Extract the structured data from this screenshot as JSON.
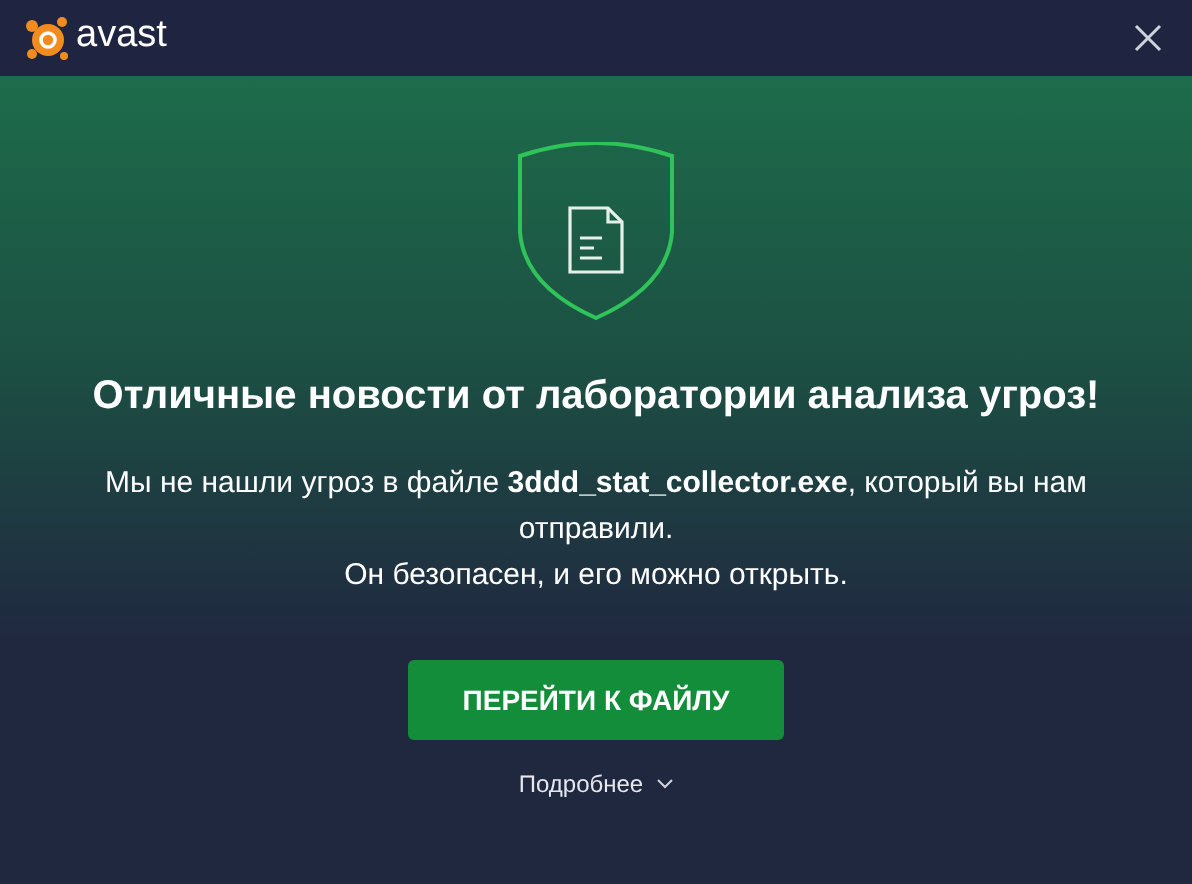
{
  "header": {
    "brand": "avast"
  },
  "title": "Отличные новости от лаборатории анализа угроз!",
  "message": [
    "Мы не нашли угроз в файле **3ddd_stat_collector.exe**, который вы нам отправили.",
    "Он безопасен, и его можно открыть."
  ],
  "primary_button": "ПЕРЕЙТИ К ФАЙЛУ",
  "details_link": "Подробнее"
}
